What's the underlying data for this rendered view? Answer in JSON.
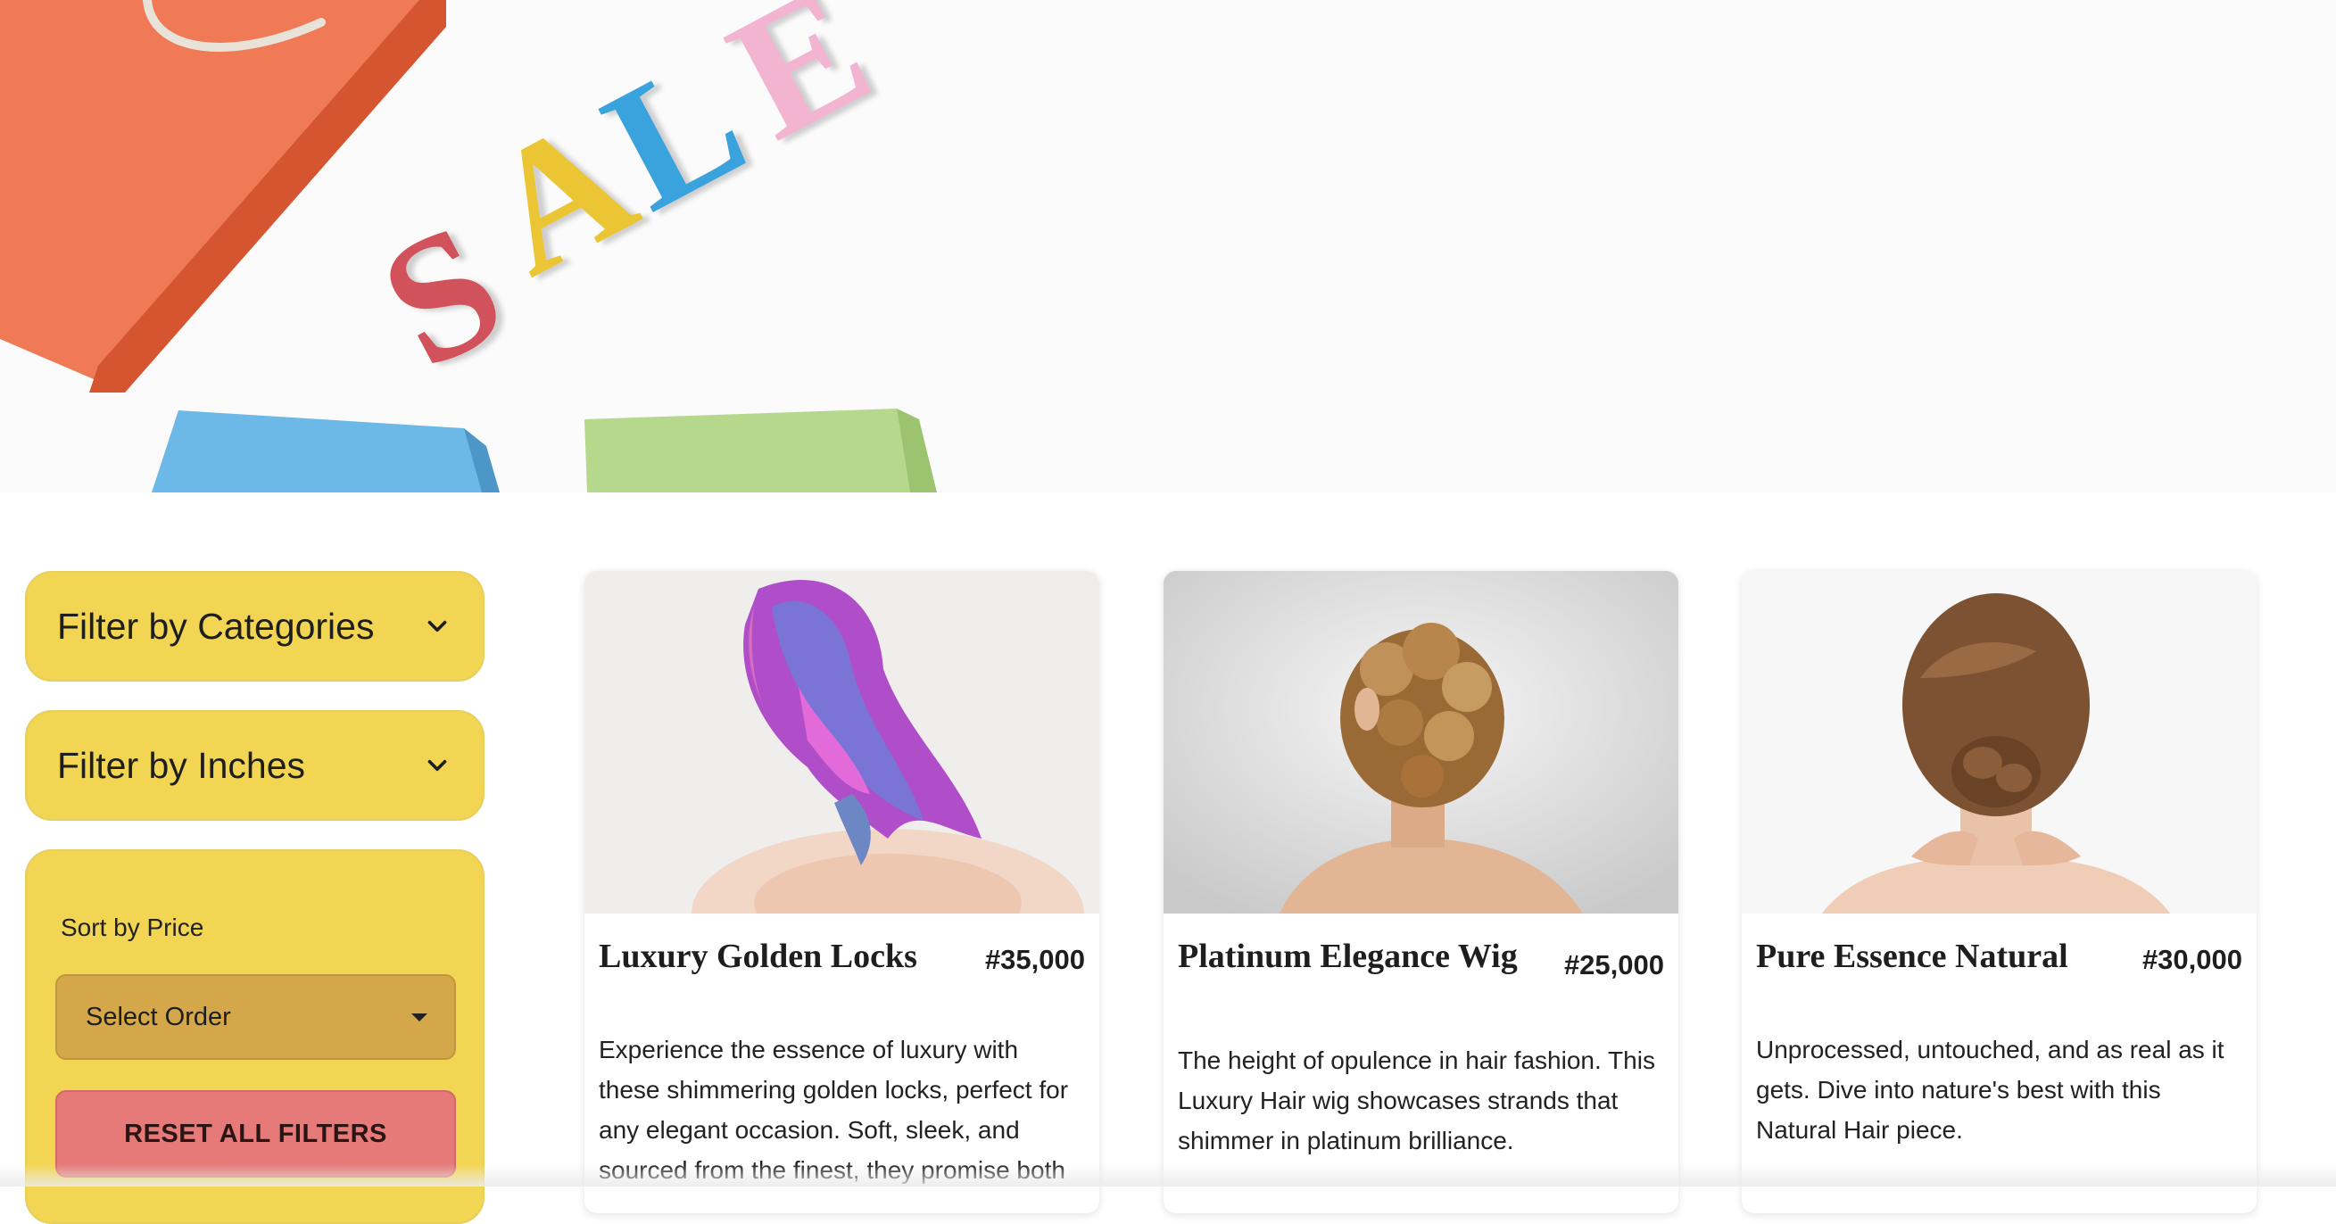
{
  "hero": {
    "banner_letters": [
      "S",
      "A",
      "L",
      "E"
    ],
    "colors": {
      "bag_orange": "#ef7a55",
      "bag_blue": "#6cb8e6",
      "bag_green": "#b5d88c",
      "letter_red": "#d2525c",
      "letter_yellow": "#ecc534",
      "letter_blue": "#3aa3dd",
      "letter_pink": "#f2b4d0"
    }
  },
  "sidebar": {
    "filter_categories_label": "Filter by Categories",
    "filter_inches_label": "Filter by Inches",
    "sort_label": "Sort by Price",
    "sort_select_value": "Select Order",
    "reset_label": "RESET ALL FILTERS",
    "colors": {
      "panel": "#f2d653",
      "select": "#d4a74a",
      "reset": "#e57a78"
    }
  },
  "products": [
    {
      "title": "Luxury Golden Locks",
      "price": "#35,000",
      "description": "Experience the essence of luxury with these shimmering golden locks, perfect for any elegant occasion. Soft, sleek, and sourced from the finest, they promise both",
      "image": "woman with long wavy purple and blue dyed hair, back view"
    },
    {
      "title": "Platinum Elegance Wig",
      "price": "#25,000",
      "description": "The height of opulence in hair fashion. This Luxury Hair wig showcases strands that shimmer in platinum brilliance.",
      "image": "woman with curly blonde updo, back view"
    },
    {
      "title": "Pure Essence Natural",
      "price": "#30,000",
      "description": "Unprocessed, untouched, and as real as it gets. Dive into nature's best with this Natural Hair piece.",
      "image": "woman with brown braided bun, back view"
    }
  ]
}
